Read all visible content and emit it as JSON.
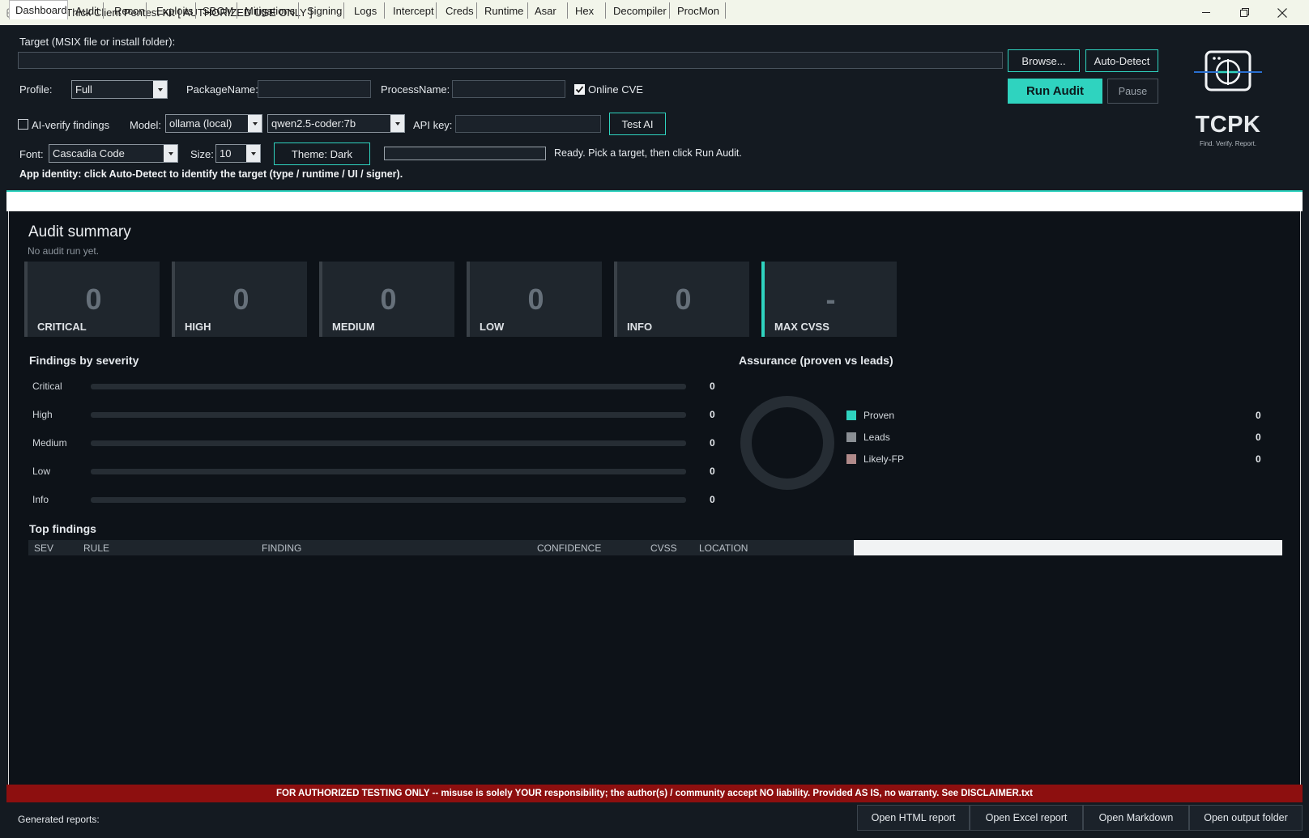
{
  "window": {
    "title": "TCPK -- Thick Client Pentest Kit   [ AUTHORIZED USE ONLY ]",
    "controls": [
      "minimize-icon",
      "restore-icon",
      "close-icon"
    ]
  },
  "target": {
    "label": "Target (MSIX file or install folder):",
    "value": "",
    "browse_label": "Browse...",
    "autodetect_label": "Auto-Detect"
  },
  "profile": {
    "label": "Profile:",
    "value": "Full"
  },
  "package": {
    "label": "PackageName:",
    "value": ""
  },
  "process": {
    "label": "ProcessName:",
    "value": ""
  },
  "online_cve": {
    "label": "Online CVE",
    "checked": true
  },
  "actions": {
    "run_label": "Run Audit",
    "pause_label": "Pause"
  },
  "ai": {
    "verify_label": "AI-verify findings",
    "verify_checked": false,
    "model_label": "Model:",
    "provider_value": "ollama (local)",
    "model_value": "qwen2.5-coder:7b",
    "apikey_label": "API key:",
    "apikey_value": "",
    "test_label": "Test AI"
  },
  "font": {
    "label": "Font:",
    "value": "Cascadia Code",
    "size_label": "Size:",
    "size_value": "10"
  },
  "theme_label": "Theme: Dark",
  "progress_value": 0,
  "status": "Ready. Pick a target, then click Run Audit.",
  "identity": "App identity: click Auto-Detect to identify the target (type / runtime / UI / signer).",
  "logo": {
    "wordmark": "TCPK",
    "tagline": "Find. Verify. Report.",
    "accent": "#2fd3bf"
  },
  "tabs": [
    "Dashboard",
    "Audit",
    "Recon",
    "Exploits",
    "SBOM",
    "Mitigations",
    "Signing",
    "Logs",
    "Intercept",
    "Creds",
    "Runtime",
    "Asar",
    "Hex",
    "Decompiler",
    "ProcMon"
  ],
  "active_tab": "Dashboard",
  "summary": {
    "title": "Audit summary",
    "subtitle": "No audit run yet.",
    "cards": [
      {
        "value": "0",
        "label": "CRITICAL"
      },
      {
        "value": "0",
        "label": "HIGH"
      },
      {
        "value": "0",
        "label": "MEDIUM"
      },
      {
        "value": "0",
        "label": "LOW"
      },
      {
        "value": "0",
        "label": "INFO"
      },
      {
        "value": "-",
        "label": "MAX CVSS"
      }
    ]
  },
  "severity": {
    "title": "Findings by severity",
    "rows": [
      {
        "label": "Critical",
        "count": "0"
      },
      {
        "label": "High",
        "count": "0"
      },
      {
        "label": "Medium",
        "count": "0"
      },
      {
        "label": "Low",
        "count": "0"
      },
      {
        "label": "Info",
        "count": "0"
      }
    ]
  },
  "assurance": {
    "title": "Assurance  (proven vs leads)",
    "items": [
      {
        "label": "Proven",
        "count": "0",
        "color": "#2fd3bf"
      },
      {
        "label": "Leads",
        "count": "0",
        "color": "#8a8f94"
      },
      {
        "label": "Likely-FP",
        "count": "0",
        "color": "#b08a8a"
      }
    ]
  },
  "top_findings": {
    "title": "Top findings",
    "columns": [
      "SEV",
      "RULE",
      "FINDING",
      "CONFIDENCE",
      "CVSS",
      "LOCATION"
    ],
    "rows": []
  },
  "disclaimer": "FOR AUTHORIZED TESTING ONLY  --  misuse is solely YOUR responsibility; the author(s) / community accept NO liability.  Provided AS IS, no warranty.  See DISCLAIMER.txt",
  "footer": {
    "generated_label": "Generated reports:",
    "buttons": [
      "Open HTML report",
      "Open Excel report",
      "Open Markdown",
      "Open output folder"
    ]
  },
  "colors": {
    "accent": "#2fd3bf",
    "background": "#141a21",
    "disclaimer_bg": "#8d0f0f"
  }
}
